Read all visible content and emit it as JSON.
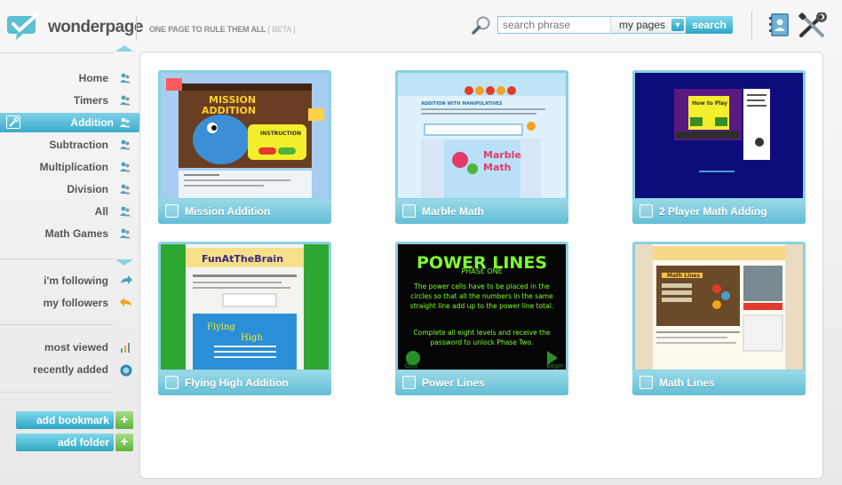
{
  "header": {
    "brand": "wonderpage",
    "tagline": "ONE PAGE TO RULE THEM ALL",
    "beta": "[ BETA ]",
    "search": {
      "placeholder": "search phrase",
      "scope": "my pages",
      "button": "search"
    }
  },
  "sidebar": {
    "categories": [
      {
        "label": "Home"
      },
      {
        "label": "Timers"
      },
      {
        "label": "Addition",
        "active": true
      },
      {
        "label": "Subtraction"
      },
      {
        "label": "Multiplication"
      },
      {
        "label": "Division"
      },
      {
        "label": "All"
      },
      {
        "label": "Math Games"
      }
    ],
    "social": [
      {
        "label": "i'm following"
      },
      {
        "label": "my followers"
      }
    ],
    "stats": [
      {
        "label": "most viewed"
      },
      {
        "label": "recently added"
      }
    ],
    "buttons": {
      "add_bookmark": "add bookmark",
      "add_folder": "add folder",
      "plus": "+"
    }
  },
  "tiles": [
    {
      "title": "Mission Addition"
    },
    {
      "title": "Marble Math"
    },
    {
      "title": "2 Player Math Adding"
    },
    {
      "title": "Flying High Addition"
    },
    {
      "title": "Power Lines"
    },
    {
      "title": "Math Lines"
    }
  ],
  "thumbnails": {
    "mission": {
      "line1": "MISSION",
      "line2": "ADDITION",
      "instruction": "INSTRUCTION"
    },
    "marble": {
      "header": "ADDITION WITH MANIPULATIVES",
      "line1": "Marble",
      "line2": "Math"
    },
    "twoplayer": {
      "title": "How to Play"
    },
    "flying": {
      "banner": "FunAtTheBrain",
      "line1": "Flying",
      "line2": "High"
    },
    "power": {
      "title": "POWER LINES",
      "phase": "PHASE ONE",
      "body1": "The power cells have to be placed in the circles so that all the numbers in the same straight line add up to the power line total.",
      "body2": "Complete all eight levels and receive the password to unlock Phase Two.",
      "quit": "Quit",
      "begin": "Begin"
    },
    "mathlines": {
      "title": "Math Lines"
    }
  },
  "colors": {
    "accent": "#3aabcb",
    "accent_light": "#8ad0e1",
    "plus_green": "#5db33b",
    "brand_teal": "#5bbfd6"
  }
}
